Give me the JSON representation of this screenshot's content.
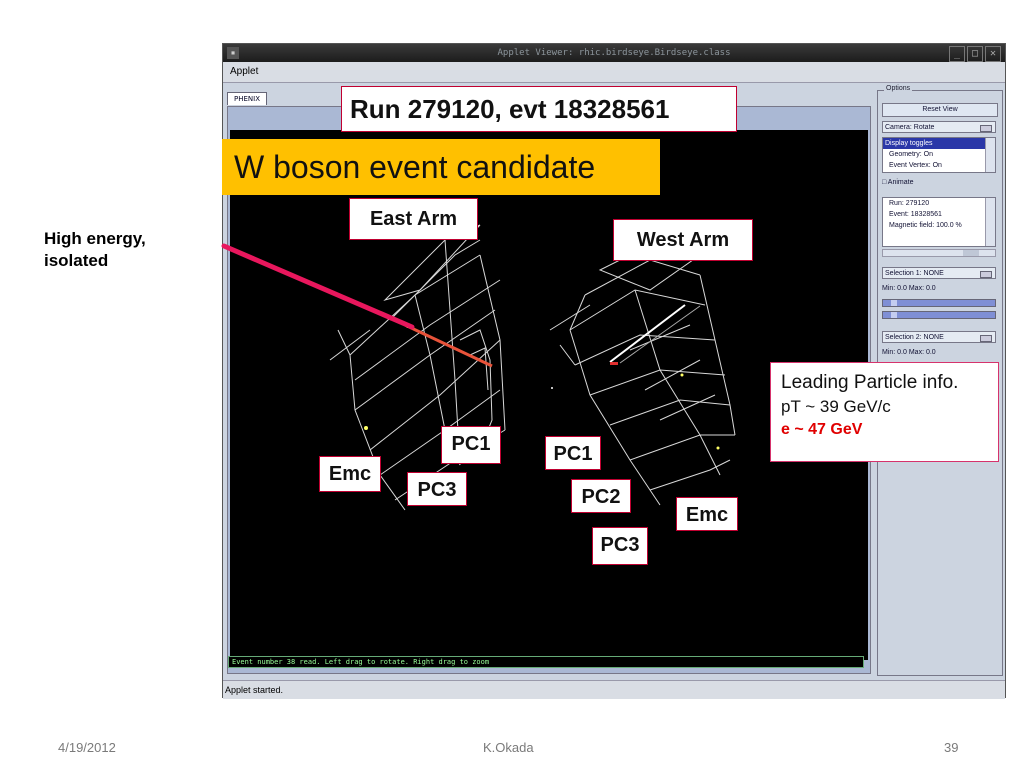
{
  "annotation": {
    "side_note": "High energy,\nisolated"
  },
  "window": {
    "title": "Applet Viewer: rhic.birdseye.Birdseye.class",
    "menu": "Applet",
    "tab": "PHENIX",
    "status_line": "Event number 38 read. Left drag to rotate. Right drag to zoom",
    "applet_status": "Applet started."
  },
  "options": {
    "legend": "Options",
    "reset_view": "Reset View",
    "camera": "Camera: Rotate",
    "display_toggles": [
      "Display toggles",
      "Geometry: On",
      "Event Vertex: On"
    ],
    "animate": "Animate",
    "info": [
      "Run: 279120",
      "Event: 18328561",
      "Magnetic field: 100.0 %"
    ],
    "selection1": "Selection 1: NONE",
    "selection1_range": "Min: 0.0   Max: 0.0",
    "selection2": "Selection 2: NONE",
    "selection2_range": "Min: 0.0   Max: 0.0"
  },
  "callouts": {
    "run": "Run 279120, evt 18328561",
    "banner": "W boson event candidate",
    "east_arm": "East Arm",
    "west_arm": "West Arm",
    "pc1_east": "PC1",
    "emc_east": "Emc",
    "pc3_east": "PC3",
    "pc1_west": "PC1",
    "pc2_west": "PC2",
    "emc_west": "Emc",
    "pc3_west": "PC3"
  },
  "leading": {
    "title": "Leading Particle info.",
    "pt": "pT ~ 39 GeV/c",
    "energy": "e ~ 47 GeV"
  },
  "footer": {
    "date": "4/19/2012",
    "author": "K.Okada",
    "page": "39"
  },
  "colors": {
    "accent": "#ffc000",
    "track": "#e8175d",
    "energy": "#e00000"
  }
}
